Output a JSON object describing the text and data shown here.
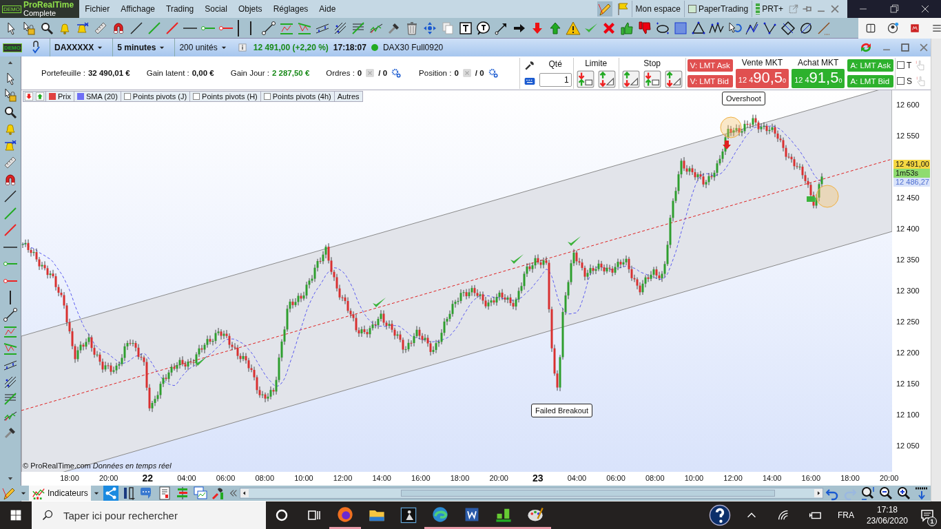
{
  "app": {
    "badge": "DEMO",
    "title": "ProRealTime",
    "edition": "Complete"
  },
  "menu": [
    "Fichier",
    "Affichage",
    "Trading",
    "Social",
    "Objets",
    "Réglages",
    "Aide"
  ],
  "title_bar_right": {
    "workspace": "Mon espace",
    "paper_trading": "PaperTrading",
    "prt_plus": "PRT+"
  },
  "instrument_bar": {
    "badge": "DEMO",
    "symbol": "DAXXXXX",
    "timeframe": "5 minutes",
    "units": "200 unités",
    "price": "12 491,00",
    "change": "(+2,20 %)",
    "time": "17:18:07",
    "contract": "DAX30 Full0920"
  },
  "account": [
    {
      "kind": "money",
      "label": "Portefeuille :",
      "value": "32 490,01 €"
    },
    {
      "kind": "money",
      "label": "Gain latent :",
      "value": "0,00 €"
    },
    {
      "kind": "gain",
      "label": "Gain Jour :",
      "value": "2 287,50 €"
    },
    {
      "kind": "orders",
      "label": "Ordres :",
      "value": "0",
      "total": "/ 0"
    },
    {
      "kind": "orders",
      "label": "Position :",
      "value": "0",
      "total": "/ 0"
    }
  ],
  "order_panel": {
    "quantity_label": "Qté",
    "quantity": "1",
    "limit_label": "Limite",
    "stop_label": "Stop",
    "sell_limits": [
      "V: LMT Ask",
      "V: LMT Bid"
    ],
    "sell": {
      "label": "Vente MKT",
      "prefix": "12 4",
      "price": "90,5",
      "sup": "0"
    },
    "buy": {
      "label": "Achat MKT",
      "prefix": "12 4",
      "price": "91,5",
      "sup": "0"
    },
    "buy_limits": [
      "A: LMT Ask",
      "A: LMT Bid"
    ],
    "options": [
      {
        "label": "T",
        "checked": false
      },
      {
        "label": "S",
        "checked": false
      }
    ]
  },
  "legend": [
    {
      "kind": "swatch",
      "label": "Prix",
      "color": "#e04040"
    },
    {
      "kind": "swatch",
      "label": "SMA (20)",
      "color": "#6f6ff5"
    },
    {
      "kind": "checkbox",
      "label": "Points pivots (J)",
      "checked": false
    },
    {
      "kind": "checkbox",
      "label": "Points pivots (H)",
      "checked": false
    },
    {
      "kind": "checkbox",
      "label": "Points pivots (4h)",
      "checked": false
    },
    {
      "kind": "plain",
      "label": "Autres"
    }
  ],
  "chart": {
    "annotations": [
      "Overshoot",
      "Failed Breakout"
    ],
    "copyright": "© ProRealTime.com",
    "realtime": "Données en temps réel",
    "price_tags": [
      {
        "kind": "last",
        "text": "12 491,00"
      },
      {
        "kind": "timer",
        "text": "1m53s"
      },
      {
        "kind": "sma",
        "text": "12 486,27"
      }
    ],
    "y_axis_labels": [
      "12 600",
      "12 550",
      "12 450",
      "12 400",
      "12 350",
      "12 300",
      "12 250",
      "12 200",
      "12 150",
      "12 100",
      "12 050"
    ],
    "x_axis_labels": [
      {
        "kind": "time",
        "text": "18:00"
      },
      {
        "kind": "time",
        "text": "20:00"
      },
      {
        "kind": "day",
        "text": "22"
      },
      {
        "kind": "time",
        "text": "04:00"
      },
      {
        "kind": "time",
        "text": "06:00"
      },
      {
        "kind": "time",
        "text": "08:00"
      },
      {
        "kind": "time",
        "text": "10:00"
      },
      {
        "kind": "time",
        "text": "12:00"
      },
      {
        "kind": "time",
        "text": "14:00"
      },
      {
        "kind": "time",
        "text": "16:00"
      },
      {
        "kind": "time",
        "text": "18:00"
      },
      {
        "kind": "time",
        "text": "20:00"
      },
      {
        "kind": "day",
        "text": "23"
      },
      {
        "kind": "time",
        "text": "04:00"
      },
      {
        "kind": "time",
        "text": "06:00"
      },
      {
        "kind": "time",
        "text": "08:00"
      },
      {
        "kind": "time",
        "text": "10:00"
      },
      {
        "kind": "time",
        "text": "12:00"
      },
      {
        "kind": "time",
        "text": "14:00"
      },
      {
        "kind": "time",
        "text": "16:00"
      },
      {
        "kind": "time",
        "text": "18:00"
      },
      {
        "kind": "time",
        "text": "20:00"
      }
    ]
  },
  "bottom_toolbar": {
    "indicators": "Indicateurs"
  },
  "taskbar": {
    "search_placeholder": "Taper ici pour rechercher",
    "language": "FRA",
    "time": "17:18",
    "date": "23/06/2020",
    "notifications": "1"
  }
}
